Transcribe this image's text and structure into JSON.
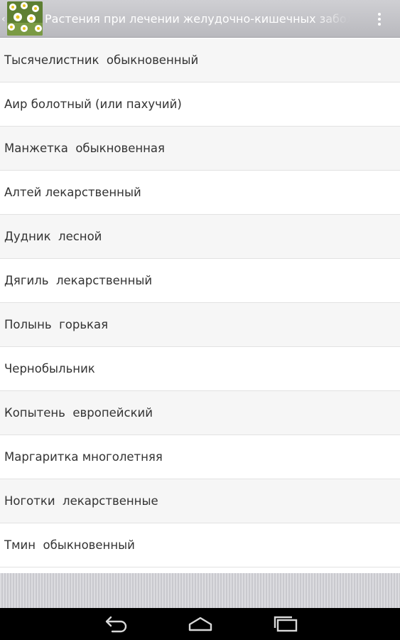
{
  "action_bar": {
    "title": "Растения при лечении желудочно-кишечных заболеваний",
    "up_icon": "chevron-left-icon",
    "app_icon": "chamomile-app-icon",
    "menu_icon": "overflow-menu-icon"
  },
  "plants": [
    "Тысячелистник  обыкновенный",
    "Аир болотный (или пахучий)",
    "Манжетка  обыкновенная",
    "Алтей лекарственный",
    "Дудник  лесной",
    "Дягиль  лекарственный",
    "Полынь  горькая",
    "Чернобыльник",
    "Копытень  европейский",
    "Маргаритка многолетняя",
    "Ноготки  лекарственные",
    "Тмин  обыкновенный"
  ],
  "nav_bar": {
    "back_icon": "back-icon",
    "home_icon": "home-icon",
    "recent_icon": "recent-apps-icon"
  },
  "colors": {
    "action_bar": "#c4c4c8",
    "row_odd": "#f6f6f6",
    "row_even": "#ffffff",
    "text": "#333333",
    "nav_bar": "#000000"
  }
}
